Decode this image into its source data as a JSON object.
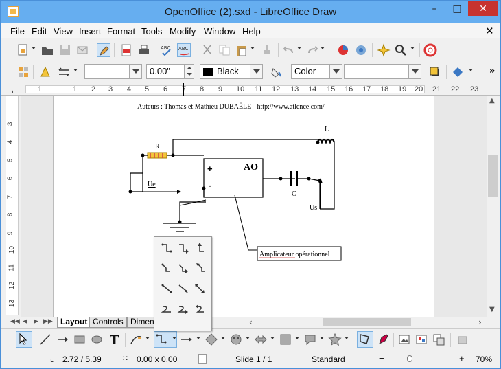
{
  "window": {
    "title": "OpenOffice (2).sxd - LibreOffice Draw"
  },
  "menu": [
    "File",
    "Edit",
    "View",
    "Insert",
    "Format",
    "Tools",
    "Modify",
    "Window",
    "Help"
  ],
  "format_bar": {
    "line_width": "0.00\"",
    "line_color": "Black",
    "area_style": "Color",
    "area_value": ""
  },
  "ruler": {
    "h": [
      "1",
      "1",
      "2",
      "3",
      "4",
      "5",
      "6",
      "7",
      "8",
      "9",
      "10",
      "11",
      "12",
      "13",
      "14",
      "15",
      "16",
      "17",
      "18",
      "19",
      "20",
      "21",
      "22",
      "23"
    ],
    "v": [
      "3",
      "4",
      "5",
      "6",
      "7",
      "8",
      "9",
      "10",
      "11",
      "12",
      "13"
    ]
  },
  "drawing": {
    "header": "Auteurs : Thomas et Mathieu DUBAËLE - http://www.atlence.com/",
    "label_R": "R",
    "label_L": "L",
    "label_AO": "AO",
    "label_plus": "+",
    "label_minus": "-",
    "label_C": "C",
    "label_Ue": "Ue",
    "label_Us": "Us",
    "label_callout": "Amplicateur opérationnel"
  },
  "tabs": [
    "Layout",
    "Controls",
    "Dimen"
  ],
  "status": {
    "position": "2.72 / 5.39",
    "size": "0.00 x 0.00",
    "slide": "Slide 1 / 1",
    "master": "Standard",
    "zoom": "70%"
  },
  "colors": {
    "titlebar": "#66aef0",
    "close": "#c7332f",
    "accent": "#3b78c4"
  }
}
